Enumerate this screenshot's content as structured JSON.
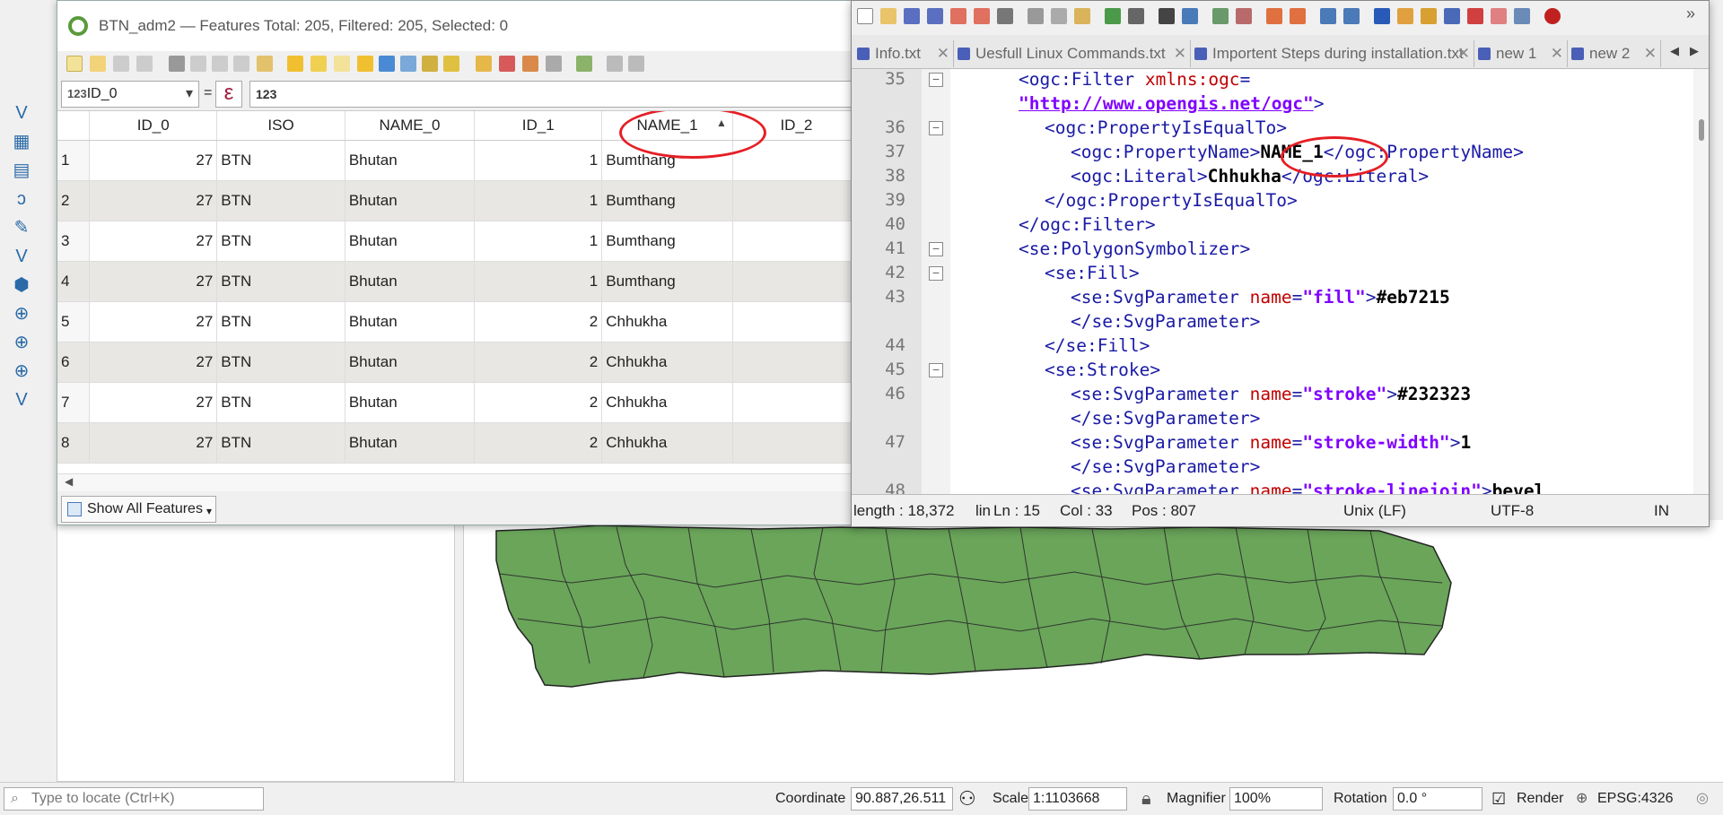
{
  "qgis": {
    "status": {
      "locate_placeholder": "Type to locate (Ctrl+K)",
      "coordinate_label": "Coordinate",
      "coordinate_value": "90.887,26.511",
      "scale_label": "Scale",
      "scale_value": "1:1103668",
      "magnifier_label": "Magnifier",
      "magnifier_value": "100%",
      "rotation_label": "Rotation",
      "rotation_value": "0.0 °",
      "render_label": "Render",
      "crs": "EPSG:4326"
    },
    "map_fill_color": "#6aa55a",
    "map_stroke_color": "#232323"
  },
  "attr_table": {
    "title": "BTN_adm2 — Features Total: 205, Filtered: 205, Selected: 0",
    "field_select": "ID_0",
    "field_prefix": "123",
    "operator": "=",
    "expression_value": "123",
    "columns": [
      "ID_0",
      "ISO",
      "NAME_0",
      "ID_1",
      "NAME_1",
      "ID_2"
    ],
    "rows": [
      [
        "1",
        "27",
        "BTN",
        "Bhutan",
        "1",
        "Bumthang"
      ],
      [
        "2",
        "27",
        "BTN",
        "Bhutan",
        "1",
        "Bumthang"
      ],
      [
        "3",
        "27",
        "BTN",
        "Bhutan",
        "1",
        "Bumthang"
      ],
      [
        "4",
        "27",
        "BTN",
        "Bhutan",
        "1",
        "Bumthang"
      ],
      [
        "5",
        "27",
        "BTN",
        "Bhutan",
        "2",
        "Chhukha"
      ],
      [
        "6",
        "27",
        "BTN",
        "Bhutan",
        "2",
        "Chhukha"
      ],
      [
        "7",
        "27",
        "BTN",
        "Bhutan",
        "2",
        "Chhukha"
      ],
      [
        "8",
        "27",
        "BTN",
        "Bhutan",
        "2",
        "Chhukha"
      ]
    ],
    "show_all": "Show All Features"
  },
  "npp": {
    "tabs": [
      {
        "label": "Info.txt"
      },
      {
        "label": "Uesfull Linux Commands.txt"
      },
      {
        "label": "Importent Steps during installation.txt"
      },
      {
        "label": "new 1"
      },
      {
        "label": "new 2"
      }
    ],
    "line_numbers": [
      "35",
      "",
      "36",
      "37",
      "38",
      "39",
      "40",
      "41",
      "42",
      "43",
      "",
      "44",
      "45",
      "46",
      "",
      "47",
      "",
      "48"
    ],
    "code": {
      "l35a_open": "<ogc:Filter ",
      "l35a_attr": "xmlns:ogc",
      "l35a_eq": "=",
      "l35b_url": "\"http://www.opengis.net/ogc\"",
      "l35b_close": ">",
      "l36": "<ogc:PropertyIsEqualTo>",
      "l37_open": "<ogc:PropertyName>",
      "l37_txt": "NAME_1",
      "l37_close": "</ogc:PropertyName>",
      "l38_open": "<ogc:Literal>",
      "l38_txt": "Chhukha",
      "l38_close": "</ogc:Literal>",
      "l39": "</ogc:PropertyIsEqualTo>",
      "l40": "</ogc:Filter>",
      "l41": "<se:PolygonSymbolizer>",
      "l42": "<se:Fill>",
      "l43_open": "<se:SvgParameter ",
      "l43_attr": "name",
      "l43_eq": "=",
      "l43_val": "\"fill\"",
      "l43_gt": ">",
      "l43_txt": "#eb7215",
      "l43b": "</se:SvgParameter>",
      "l44": "</se:Fill>",
      "l45": "<se:Stroke>",
      "l46_val": "\"stroke\"",
      "l46_txt": "#232323",
      "l47_val": "\"stroke-width\"",
      "l47_txt": "1",
      "l48_val": "\"stroke-linejoin\"",
      "l48_txt": "bevel"
    },
    "status": {
      "length": "length : 18,372",
      "lin": "lin",
      "ln": "Ln : 15",
      "col": "Col : 33",
      "pos": "Pos : 807",
      "eol": "Unix (LF)",
      "encoding": "UTF-8",
      "mode": "IN"
    }
  }
}
